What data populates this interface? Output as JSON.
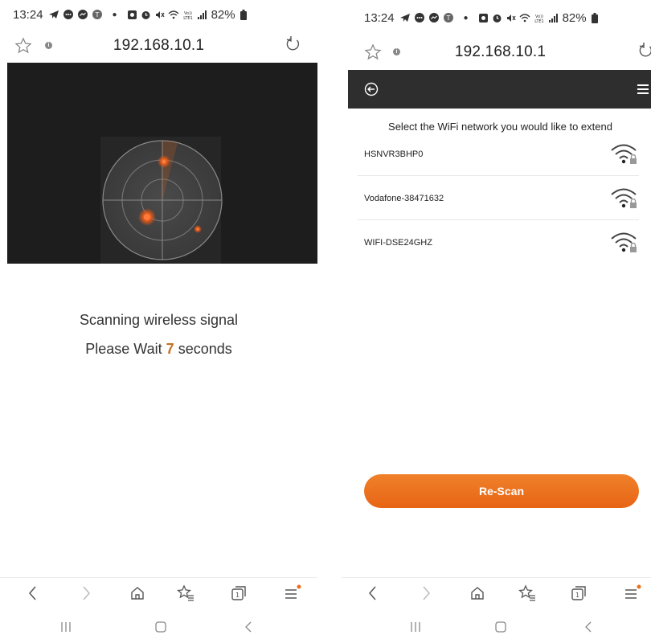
{
  "status_bar": {
    "time": "13:24",
    "battery": "82%"
  },
  "browser": {
    "url": "192.168.10.1"
  },
  "scanning_screen": {
    "line1": "Scanning wireless signal",
    "wait_prefix": "Please Wait",
    "seconds": "7",
    "wait_suffix": "seconds"
  },
  "network_screen": {
    "title": "Select the WiFi network you would like to extend",
    "networks": [
      {
        "ssid": "HSNVR3BHP0",
        "locked": true
      },
      {
        "ssid": "Vodafone-38471632",
        "locked": true
      },
      {
        "ssid": "WIFI-DSE24GHZ",
        "locked": true
      }
    ],
    "rescan_label": "Re-Scan"
  },
  "colors": {
    "accent": "#e8711c",
    "header_dark": "#2e2e2e",
    "scanner_bg": "#1d1d1d"
  },
  "icons": {
    "status": [
      "telegram-icon",
      "chat-icon",
      "messenger-icon",
      "t-icon",
      "alarm-icon",
      "alarm-clock-icon",
      "mute-icon",
      "wifi-icon",
      "volte-icon",
      "signal-icon",
      "battery-icon"
    ],
    "browser": [
      "star-icon",
      "info-icon",
      "reload-icon"
    ],
    "nav": [
      "back-icon",
      "forward-icon",
      "home-icon",
      "bookmarks-icon",
      "tabs-icon",
      "menu-icon"
    ],
    "system": [
      "recent-apps-icon",
      "home-button-icon",
      "back-system-icon"
    ]
  }
}
